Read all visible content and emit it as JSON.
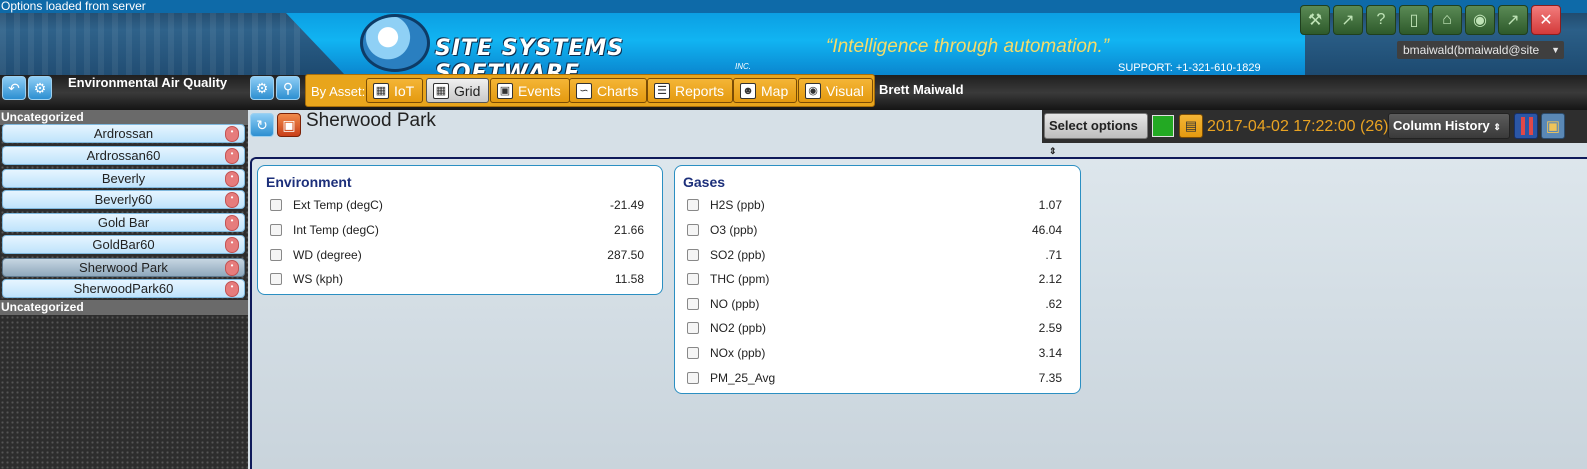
{
  "header": {
    "status_line": "Options loaded from server",
    "company_name": "SITE SYSTEMS SOFTWARE",
    "company_suffix": "INC.",
    "tagline": "“Intelligence through automation.”",
    "support": "SUPPORT: +1-321-610-1829",
    "user_email": "bmaiwald(bmaiwald@site",
    "top_icons": [
      "wrench-icon",
      "trend-icon",
      "help-icon",
      "mobile-icon",
      "home-icon",
      "target-icon",
      "expand-icon",
      "close-icon"
    ]
  },
  "toolbar": {
    "app_title": "Environmental Air Quality",
    "by_asset_label": "By Asset:",
    "nav": [
      {
        "label": "IoT",
        "icon": "iot-grid-icon"
      },
      {
        "label": "Grid",
        "icon": "grid-icon"
      },
      {
        "label": "Events",
        "icon": "calendar-icon"
      },
      {
        "label": "Charts",
        "icon": "chart-icon"
      },
      {
        "label": "Reports",
        "icon": "clipboard-icon"
      },
      {
        "label": "Map",
        "icon": "map-person-icon"
      },
      {
        "label": "Visual",
        "icon": "eye-icon"
      }
    ],
    "active_nav": "Grid",
    "user_name": "Brett Maiwald"
  },
  "sidebar": {
    "groups": [
      {
        "name": "Uncategorized",
        "items": [
          "Ardrossan",
          "Ardrossan60",
          "Beverly",
          "Beverly60",
          "Gold Bar",
          "GoldBar60",
          "Sherwood Park",
          "SherwoodPark60"
        ]
      },
      {
        "name": "Uncategorized",
        "items": []
      }
    ],
    "selected": "Sherwood Park"
  },
  "main": {
    "page_title": "Sherwood Park",
    "select_options": "Select options",
    "timestamp": "2017-04-02 17:22:00 (26)",
    "column_history": "Column History",
    "status_color": "#23a923",
    "panels": [
      {
        "title": "Environment",
        "rows": [
          {
            "label": "Ext Temp (degC)",
            "value": "-21.49"
          },
          {
            "label": "Int Temp (degC)",
            "value": "21.66"
          },
          {
            "label": "WD (degree)",
            "value": "287.50"
          },
          {
            "label": "WS (kph)",
            "value": "11.58"
          }
        ]
      },
      {
        "title": "Gases",
        "rows": [
          {
            "label": "H2S (ppb)",
            "value": "1.07"
          },
          {
            "label": "O3 (ppb)",
            "value": "46.04"
          },
          {
            "label": "SO2 (ppb)",
            "value": ".71"
          },
          {
            "label": "THC (ppm)",
            "value": "2.12"
          },
          {
            "label": "NO (ppb)",
            "value": ".62"
          },
          {
            "label": "NO2 (ppb)",
            "value": "2.59"
          },
          {
            "label": "NOx (ppb)",
            "value": "3.14"
          },
          {
            "label": "PM_25_Avg",
            "value": "7.35"
          }
        ]
      }
    ]
  },
  "colors": {
    "accent_orange": "#e8a51c",
    "timestamp": "#e9a322",
    "panel_title": "#1c2f7a",
    "tagline": "#f5dc6a"
  }
}
